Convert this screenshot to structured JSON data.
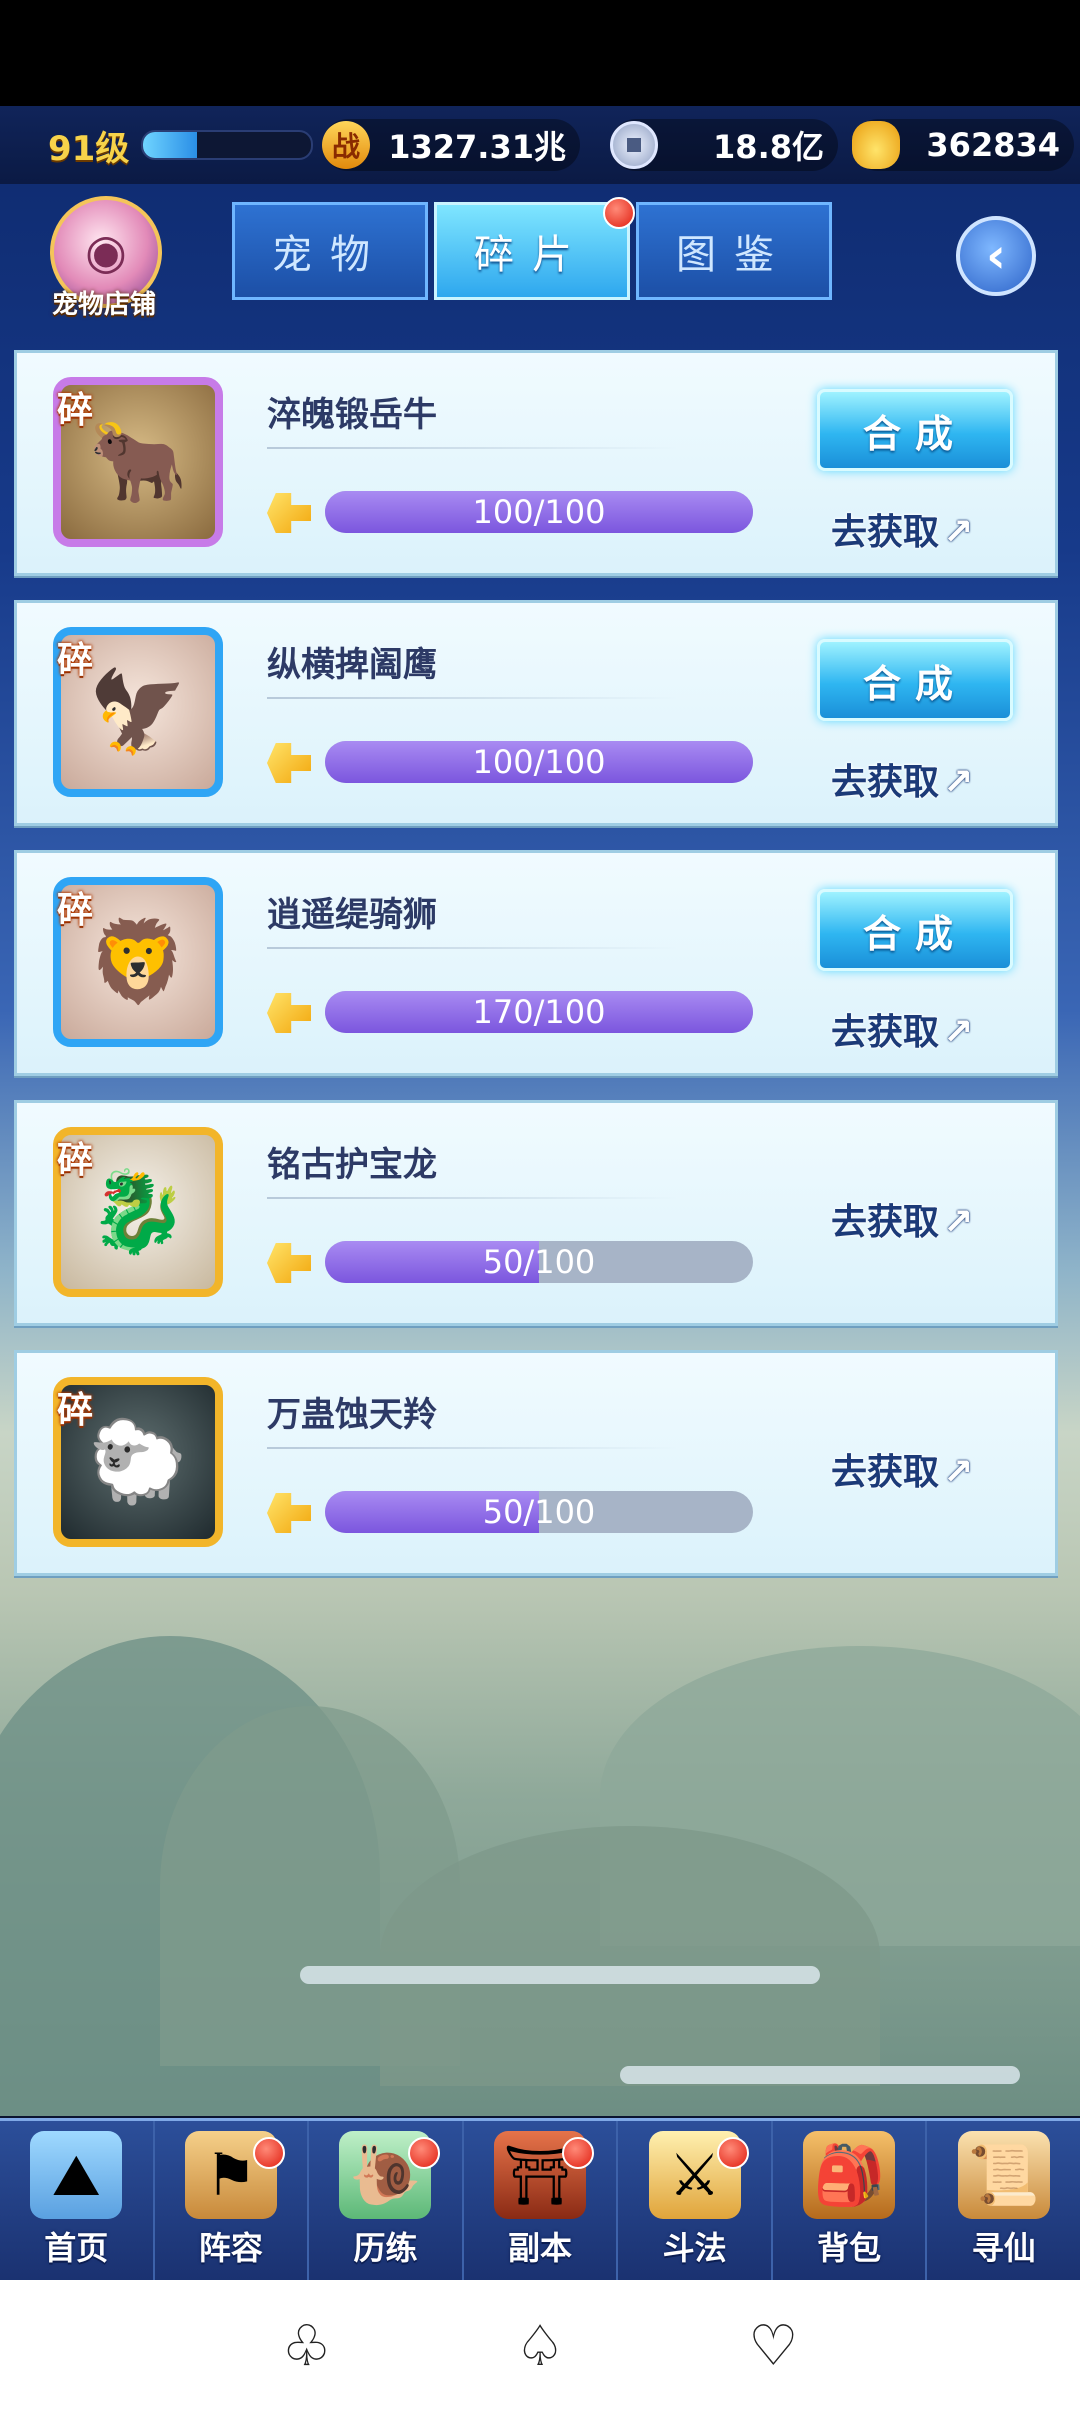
{
  "resources": {
    "level": "91级",
    "xp_fraction": 0.32,
    "power": "1327.31兆",
    "coins": "18.8亿",
    "ingots": "362834",
    "power_icon_glyph": "战"
  },
  "header": {
    "shop_label": "宠物店铺",
    "tabs": [
      {
        "label": "宠物"
      },
      {
        "label": "碎片"
      },
      {
        "label": "图鉴"
      }
    ],
    "back_glyph": "‹"
  },
  "fragments": [
    {
      "tag": "碎",
      "name": "淬魄锻岳牛",
      "progress": "100/100",
      "fill": 1.0,
      "compose": "合成",
      "get": "去获取",
      "frame": "purple"
    },
    {
      "tag": "碎",
      "name": "纵横捭阖鹰",
      "progress": "100/100",
      "fill": 1.0,
      "compose": "合成",
      "get": "去获取",
      "frame": "blue"
    },
    {
      "tag": "碎",
      "name": "逍遥缇骑狮",
      "progress": "170/100",
      "fill": 1.0,
      "compose": "合成",
      "get": "去获取",
      "frame": "blue"
    },
    {
      "tag": "碎",
      "name": "铭古护宝龙",
      "progress": "50/100",
      "fill": 0.5,
      "get": "去获取",
      "frame": "gold"
    },
    {
      "tag": "碎",
      "name": "万蛊蚀天羚",
      "progress": "50/100",
      "fill": 0.5,
      "get": "去获取",
      "frame": "gold"
    }
  ],
  "nav": [
    {
      "label": "首页",
      "icon": "home-icon"
    },
    {
      "label": "阵容",
      "icon": "lineup-icon"
    },
    {
      "label": "历练",
      "icon": "training-icon"
    },
    {
      "label": "副本",
      "icon": "dungeon-icon"
    },
    {
      "label": "斗法",
      "icon": "battle-icon"
    },
    {
      "label": "背包",
      "icon": "bag-icon"
    },
    {
      "label": "寻仙",
      "icon": "quest-icon"
    }
  ],
  "arrow_glyph": "↗"
}
